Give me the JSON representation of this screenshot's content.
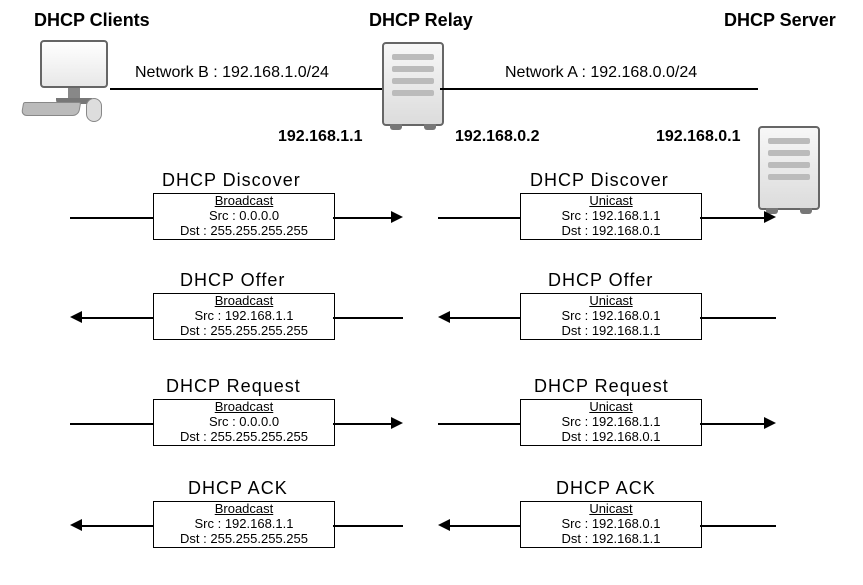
{
  "nodes": {
    "client": {
      "title": "DHCP Clients"
    },
    "relay": {
      "title": "DHCP Relay",
      "ip_left": "192.168.1.1",
      "ip_right": "192.168.0.2"
    },
    "server": {
      "title": "DHCP Server",
      "ip": "192.168.0.1"
    }
  },
  "networks": {
    "b": {
      "label": "Network B : 192.168.1.0/24"
    },
    "a": {
      "label": "Network A : 192.168.0.0/24"
    }
  },
  "messages": {
    "left": [
      {
        "name": "DHCP  Discover",
        "cast": "Broadcast",
        "src": "Src : 0.0.0.0",
        "dst": "Dst : 255.255.255.255",
        "dir": "right"
      },
      {
        "name": "DHCP  Offer",
        "cast": "Broadcast",
        "src": "Src : 192.168.1.1",
        "dst": "Dst : 255.255.255.255",
        "dir": "left"
      },
      {
        "name": "DHCP  Request",
        "cast": "Broadcast",
        "src": "Src : 0.0.0.0",
        "dst": "Dst : 255.255.255.255",
        "dir": "right"
      },
      {
        "name": "DHCP  ACK",
        "cast": "Broadcast",
        "src": "Src : 192.168.1.1",
        "dst": "Dst : 255.255.255.255",
        "dir": "left"
      }
    ],
    "right": [
      {
        "name": "DHCP  Discover",
        "cast": "Unicast",
        "src": "Src : 192.168.1.1",
        "dst": "Dst : 192.168.0.1",
        "dir": "right"
      },
      {
        "name": "DHCP  Offer",
        "cast": "Unicast",
        "src": "Src : 192.168.0.1",
        "dst": "Dst : 192.168.1.1",
        "dir": "left"
      },
      {
        "name": "DHCP  Request",
        "cast": "Unicast",
        "src": "Src : 192.168.1.1",
        "dst": "Dst : 192.168.0.1",
        "dir": "right"
      },
      {
        "name": "DHCP  ACK",
        "cast": "Unicast",
        "src": "Src : 192.168.0.1",
        "dst": "Dst : 192.168.1.1",
        "dir": "left"
      }
    ]
  }
}
